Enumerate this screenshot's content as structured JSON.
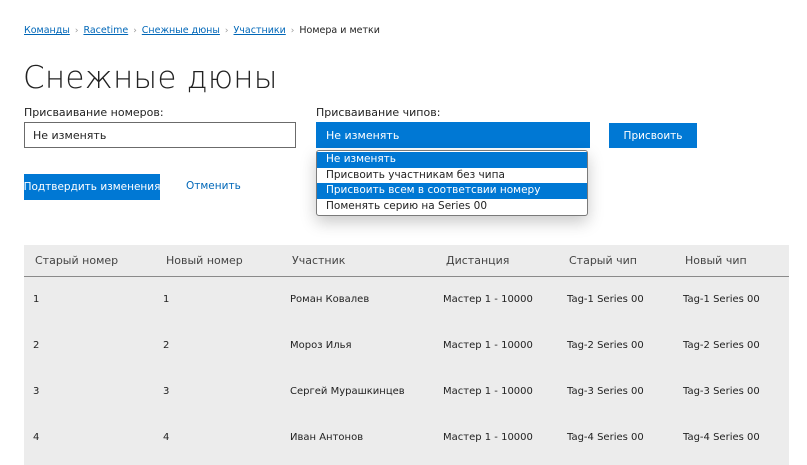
{
  "breadcrumb": {
    "items": [
      "Команды",
      "Racetime",
      "Снежные дюны",
      "Участники"
    ],
    "current": "Номера и метки",
    "separator": "›"
  },
  "page_title": "Снежные дюны",
  "number_assignment": {
    "label": "Присваивание номеров:",
    "value": "Не изменять"
  },
  "chip_assignment": {
    "label": "Присваивание чипов:",
    "value": "Не изменять",
    "options": [
      "Не изменять",
      "Присвоить участникам без чипа",
      "Присвоить всем в соответсвии номеру",
      "Поменять серию на Series 00"
    ],
    "selected_index": 0,
    "highlighted_index": 2
  },
  "buttons": {
    "assign": "Присвоить",
    "confirm": "Подтвердить изменения",
    "cancel": "Отменить"
  },
  "table": {
    "headers": [
      "Старый номер",
      "Новый номер",
      "Участник",
      "Дистанция",
      "Старый чип",
      "Новый чип"
    ],
    "rows": [
      [
        "1",
        "1",
        "Роман Ковалев",
        "Мастер 1 - 10000",
        "Tag-1 Series 00",
        "Tag-1 Series 00"
      ],
      [
        "2",
        "2",
        "Мороз Илья",
        "Мастер 1 - 10000",
        "Tag-2 Series 00",
        "Tag-2 Series 00"
      ],
      [
        "3",
        "3",
        "Сергей Мурашкинцев",
        "Мастер 1 - 10000",
        "Tag-3 Series 00",
        "Tag-3 Series 00"
      ],
      [
        "4",
        "4",
        "Иван Антонов",
        "Мастер 1 - 10000",
        "Tag-4 Series 00",
        "Tag-4 Series 00"
      ]
    ]
  },
  "colors": {
    "accent": "#0078d4",
    "link": "#0067b8",
    "table_bg": "#ececec"
  }
}
